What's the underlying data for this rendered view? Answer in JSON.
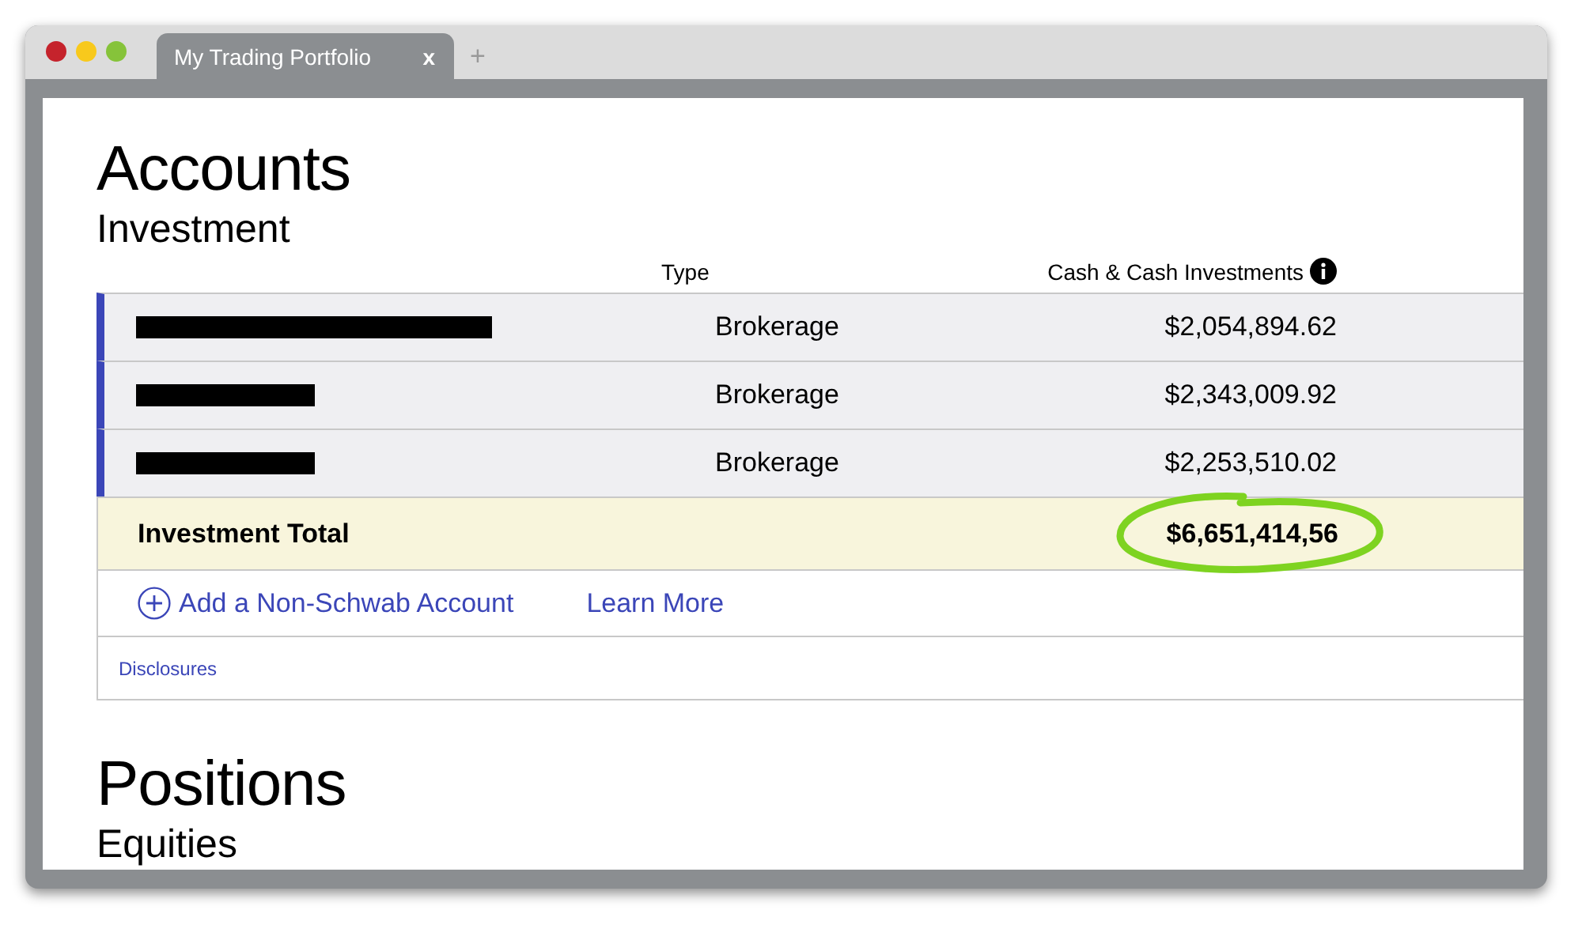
{
  "window": {
    "tab_title": "My Trading Portfolio",
    "tab_close": "x",
    "new_tab": "+"
  },
  "accounts": {
    "title": "Accounts",
    "subtitle": "Investment",
    "columns": {
      "type": "Type",
      "cash": "Cash & Cash Investments"
    },
    "rows": [
      {
        "redacted": true,
        "type": "Brokerage",
        "cash": "$2,054,894.62"
      },
      {
        "redacted": true,
        "type": "Brokerage",
        "cash": "$2,343,009.92"
      },
      {
        "redacted": true,
        "type": "Brokerage",
        "cash": "$2,253,510.02"
      }
    ],
    "total": {
      "label": "Investment Total",
      "cash": "$6,651,414,56",
      "circled": true
    },
    "add_account": "Add a Non-Schwab Account",
    "learn_more": "Learn More",
    "disclosures": "Disclosures"
  },
  "positions": {
    "title": "Positions",
    "subtitle": "Equities"
  }
}
